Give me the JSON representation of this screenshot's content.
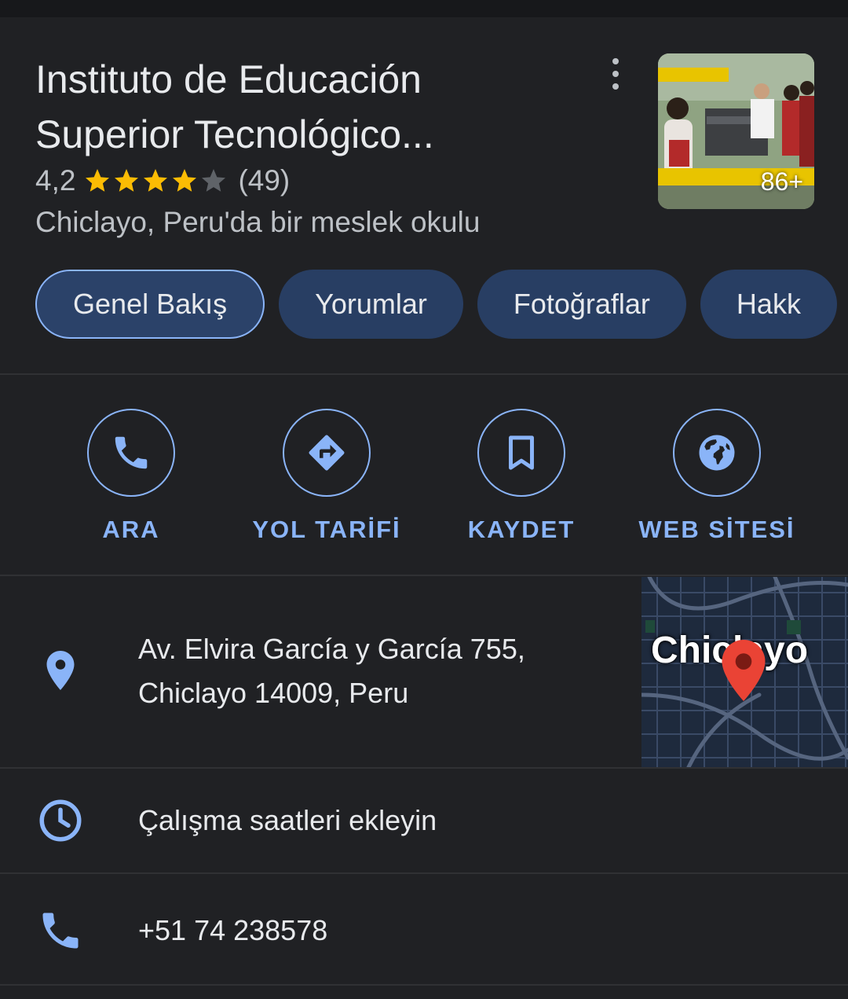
{
  "place": {
    "title_line1": "Instituto de Educación",
    "title_line2": "Superior Tecnológico...",
    "rating": "4,2",
    "stars_filled": 4,
    "stars_total": 5,
    "review_count": "(49)",
    "subtitle": "Chiclayo, Peru'da bir meslek okulu",
    "photo_count": "86+"
  },
  "tabs": [
    {
      "label": "Genel Bakış",
      "active": true
    },
    {
      "label": "Yorumlar",
      "active": false
    },
    {
      "label": "Fotoğraflar",
      "active": false
    },
    {
      "label": "Hakk",
      "active": false
    }
  ],
  "actions": [
    {
      "label": "ARA",
      "icon": "phone-icon"
    },
    {
      "label": "YOL TARİFİ",
      "icon": "directions-icon"
    },
    {
      "label": "KAYDET",
      "icon": "bookmark-icon"
    },
    {
      "label": "WEB SİTESİ",
      "icon": "globe-icon"
    }
  ],
  "address": {
    "line1": "Av. Elvira García y García 755,",
    "line2": "Chiclayo 14009, Peru",
    "icon": "location-pin-icon"
  },
  "map": {
    "city_label": "Chiclayo"
  },
  "hours": {
    "text": "Çalışma saatleri ekleyin",
    "icon": "clock-icon"
  },
  "phone": {
    "text": "+51 74 238578",
    "icon": "phone-icon"
  },
  "colors": {
    "background": "#202124",
    "accent": "#8ab4f8",
    "chip_bg": "#283e63",
    "star": "#fbbc04",
    "star_empty": "#5f6368",
    "pin": "#ea4335"
  }
}
